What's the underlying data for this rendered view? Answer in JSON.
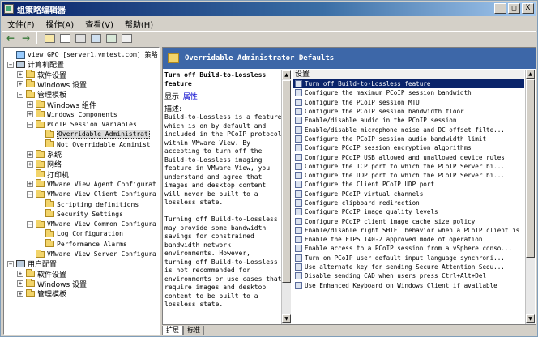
{
  "window": {
    "title": "组策略编辑器",
    "buttons": [
      "_",
      "□",
      "X"
    ]
  },
  "menu": [
    "文件(F)",
    "操作(A)",
    "查看(V)",
    "帮助(H)"
  ],
  "tree": [
    {
      "label": "view GPO [server1.vmtest.com] 策略",
      "level": 0,
      "icon": "gpo",
      "exp": "",
      "cjk": false
    },
    {
      "label": "计算机配置",
      "level": 0,
      "icon": "pc",
      "exp": "-",
      "cjk": true
    },
    {
      "label": "软件设置",
      "level": 1,
      "icon": "folder",
      "exp": "+",
      "cjk": true
    },
    {
      "label": "Windows 设置",
      "level": 1,
      "icon": "folder",
      "exp": "+",
      "cjk": true
    },
    {
      "label": "管理模板",
      "level": 1,
      "icon": "folder",
      "exp": "-",
      "cjk": true
    },
    {
      "label": "Windows 组件",
      "level": 2,
      "icon": "folder",
      "exp": "+",
      "cjk": true
    },
    {
      "label": "Windows Components",
      "level": 2,
      "icon": "folder",
      "exp": "+",
      "cjk": false
    },
    {
      "label": "PCoIP Session Variables",
      "level": 2,
      "icon": "folder",
      "exp": "-",
      "cjk": false
    },
    {
      "label": "Overridable Administrat",
      "level": 3,
      "icon": "folder",
      "exp": "",
      "cjk": false,
      "selected": true
    },
    {
      "label": "Not Overridable Administ",
      "level": 3,
      "icon": "folder",
      "exp": "",
      "cjk": false
    },
    {
      "label": "系统",
      "level": 2,
      "icon": "folder",
      "exp": "+",
      "cjk": true
    },
    {
      "label": "网络",
      "level": 2,
      "icon": "folder",
      "exp": "+",
      "cjk": true
    },
    {
      "label": "打印机",
      "level": 2,
      "icon": "folder",
      "exp": "",
      "cjk": true
    },
    {
      "label": "VMware View Agent Configurat",
      "level": 2,
      "icon": "folder",
      "exp": "+",
      "cjk": false
    },
    {
      "label": "VMware View Client Configura",
      "level": 2,
      "icon": "folder",
      "exp": "-",
      "cjk": false
    },
    {
      "label": "Scripting definitions",
      "level": 3,
      "icon": "folder",
      "exp": "",
      "cjk": false
    },
    {
      "label": "Security Settings",
      "level": 3,
      "icon": "folder",
      "exp": "",
      "cjk": false
    },
    {
      "label": "VMware View Common Configura",
      "level": 2,
      "icon": "folder",
      "exp": "-",
      "cjk": false
    },
    {
      "label": "Log Configuration",
      "level": 3,
      "icon": "folder",
      "exp": "",
      "cjk": false
    },
    {
      "label": "Performance Alarms",
      "level": 3,
      "icon": "folder",
      "exp": "",
      "cjk": false
    },
    {
      "label": "VMware View Server Configura",
      "level": 2,
      "icon": "folder",
      "exp": "",
      "cjk": false
    },
    {
      "label": "用户配置",
      "level": 0,
      "icon": "pc",
      "exp": "-",
      "cjk": true
    },
    {
      "label": "软件设置",
      "level": 1,
      "icon": "folder",
      "exp": "+",
      "cjk": true
    },
    {
      "label": "Windows 设置",
      "level": 1,
      "icon": "folder",
      "exp": "+",
      "cjk": true
    },
    {
      "label": "管理模板",
      "level": 1,
      "icon": "folder",
      "exp": "+",
      "cjk": true
    }
  ],
  "panel": {
    "header": "Overridable Administrator Defaults",
    "desc_title": "Turn off Build-to-Lossless feature",
    "display_label": "显示",
    "properties_link": "属性",
    "desc_label": "描述:",
    "desc_lines": [
      "Build-to-Lossless is a feature",
      "which is on by default and",
      "included in the PCoIP protocol",
      "within VMware View.  By",
      "accepting to turn off the",
      "Build-to-Lossless imaging",
      "feature in VMware View, you",
      "understand and agree that",
      "images and desktop content",
      "will never be built to a",
      "lossless state.",
      "",
      "Turning off Build-to-Lossless",
      "may provide some bandwidth",
      "savings for constrained",
      "bandwidth network",
      "environments.  However,",
      "turning off Build-to-Lossless",
      "is not recommended for",
      "environments or use cases that",
      "require images and desktop",
      "content to be built to a",
      "lossless state."
    ],
    "list_header": "设置",
    "settings": [
      "Turn off Build-to-Lossless feature",
      "Configure the maximum PCoIP session bandwidth",
      "Configure the PCoIP session MTU",
      "Configure the PCoIP session bandwidth floor",
      "Enable/disable audio in the PCoIP session",
      "Enable/disable microphone noise and DC offset filte...",
      "Configure the PCoIP session audio bandwidth limit",
      "Configure PCoIP session encryption algorithms",
      "Configure PCoIP USB allowed and unallowed device rules",
      "Configure the TCP port to which the PCoIP Server bi...",
      "Configure the UDP port to which the PCoIP Server bi...",
      "Configure the Client PCoIP UDP port",
      "Configure PCoIP virtual channels",
      "Configure clipboard redirection",
      "Configure PCoIP image quality levels",
      "Configure PCoIP client image cache size policy",
      "Enable/disable right SHIFT behavior when a PCoIP client is ...",
      "Enable the FIPS 140-2 approved mode of operation",
      "Enable access to a PCoIP session from a vSphere conso...",
      "Turn on PCoIP user default input language synchroni...",
      "Use alternate key for sending Secure Attention Sequ...",
      "Disable sending CAD when users press Ctrl+Alt+Del",
      "Use Enhanced Keyboard on Windows Client if available"
    ]
  },
  "tabs": [
    "扩展",
    "标准"
  ]
}
